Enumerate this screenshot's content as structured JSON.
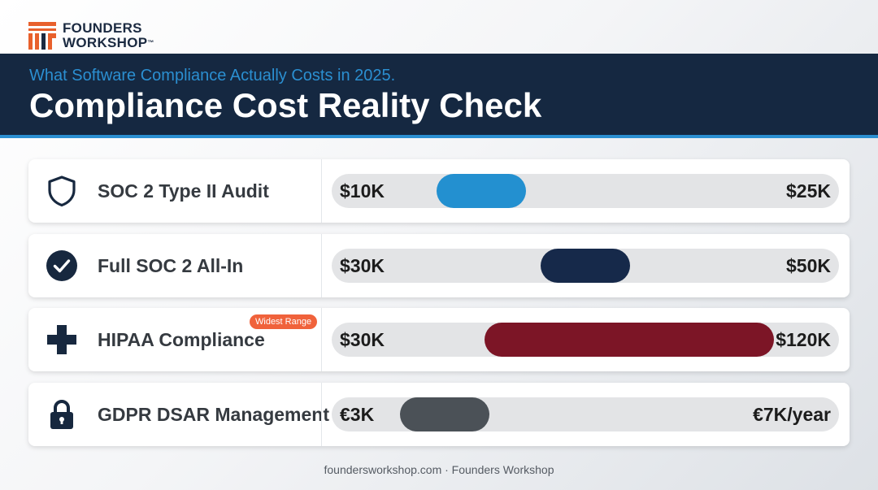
{
  "brand": {
    "line1": "FOUNDERS",
    "line2": "WORKSHOP",
    "tm": "™"
  },
  "header": {
    "subtitle": "What Software Compliance Actually Costs in 2025.",
    "title": "Compliance Cost Reality Check"
  },
  "colors": {
    "banner": "#152841",
    "accent": "#2b8fd1",
    "badge": "#f0623b"
  },
  "chart_data": {
    "type": "bar",
    "title": "Compliance Cost Reality Check",
    "categories": [
      "SOC 2 Type II Audit",
      "Full SOC 2 All-In",
      "HIPAA Compliance",
      "GDPR DSAR Management"
    ],
    "series": [
      {
        "label": "SOC 2 Type II Audit",
        "icon": "shield-icon",
        "min": 10,
        "max": 25,
        "min_label": "$10K",
        "max_label": "$25K",
        "color": "#2390d0"
      },
      {
        "label": "Full SOC 2 All-In",
        "icon": "check-circle-icon",
        "min": 30,
        "max": 50,
        "min_label": "$30K",
        "max_label": "$50K",
        "color": "#16294a"
      },
      {
        "label": "HIPAA Compliance",
        "icon": "medical-cross-icon",
        "min": 30,
        "max": 120,
        "min_label": "$30K",
        "max_label": "$120K",
        "color": "#7c1526",
        "badge": "Widest Range"
      },
      {
        "label": "GDPR DSAR Management",
        "icon": "lock-icon",
        "min": 3,
        "max": 7,
        "min_label": "€3K",
        "max_label": "€7K/year",
        "color": "#4b5157"
      }
    ]
  },
  "footer": "foundersworkshop.com · Founders Workshop"
}
